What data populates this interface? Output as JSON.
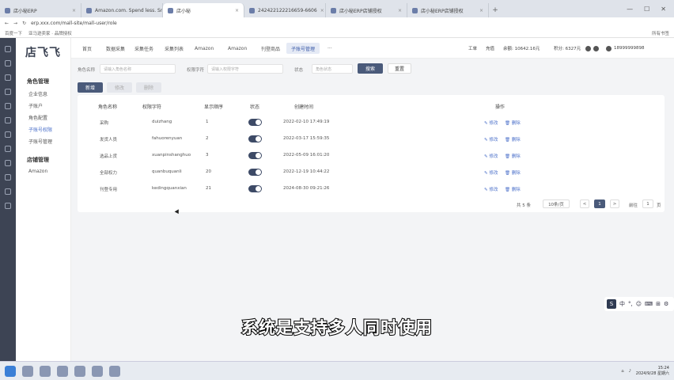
{
  "browser": {
    "tabs": [
      {
        "label": "店小秘ERP"
      },
      {
        "label": "Amazon.com. Spend less. Sr"
      },
      {
        "label": "店小秘"
      },
      {
        "label": "242422122216659-6606"
      },
      {
        "label": "店小秘ERP店铺授权"
      },
      {
        "label": "店小秘ERP店铺授权"
      }
    ],
    "active_tab": 2,
    "url": "erp.xxx.com/mall-site/mall-user/role",
    "bookmarks": [
      "百度一下",
      "亚马逊卖家 · 品牌授权"
    ],
    "bookmarks_right": "所有书签"
  },
  "app": {
    "logo": "店飞飞",
    "sidebar": {
      "groups": [
        {
          "title": "角色管理",
          "items": [
            "企业信息",
            "子账户",
            "角色配置",
            "子账号权限",
            "子账号管理"
          ]
        },
        {
          "title": "店铺管理",
          "items": [
            "Amazon"
          ]
        }
      ]
    },
    "topnav": {
      "tabs": [
        "首页",
        "数据采集",
        "采集任务",
        "采集列表",
        "Amazon",
        "Amazon",
        "刊登商品",
        "子账号管理"
      ],
      "more": "···",
      "balance_label": "工单",
      "recharge": "充值",
      "balance": "余额: 10642.16元",
      "points": "积分: 6327元",
      "phone": "18999999898"
    },
    "filters": [
      {
        "label": "角色名称",
        "placeholder": "请输入角色名称"
      },
      {
        "label": "权限字符",
        "placeholder": "请输入权限字符"
      },
      {
        "label": "状态",
        "placeholder": "角色状态"
      }
    ],
    "search_btn": "搜索",
    "reset_btn": "重置",
    "actions": [
      "新增",
      "修改",
      "删除"
    ],
    "table": {
      "headers": [
        "角色名称",
        "权限字符",
        "显示顺序",
        "状态",
        "创建时间",
        "操作"
      ],
      "rows": [
        {
          "name": "采购",
          "key": "duizhang",
          "order": "1",
          "created": "2022-02-10 17:49:19"
        },
        {
          "name": "发货人员",
          "key": "fahuorenyuan",
          "order": "2",
          "created": "2022-03-17 15:59:35"
        },
        {
          "name": "选品上货",
          "key": "xuanpinshanghuo",
          "order": "3",
          "created": "2022-05-09 16:01:20"
        },
        {
          "name": "全部权力",
          "key": "quanbuquanli",
          "order": "20",
          "created": "2022-12-19 10:44:22"
        },
        {
          "name": "刊登专用",
          "key": "kedingquanxian",
          "order": "21",
          "created": "2024-08-30 09:21:26"
        }
      ],
      "op_edit": "修改",
      "op_delete": "删除"
    },
    "pagination": {
      "total": "共 5 条",
      "page_size": "10条/页",
      "prev": "<",
      "current": "1",
      "next": ">",
      "goto": "前往",
      "goto_value": "1",
      "page_unit": "页"
    }
  },
  "subtitle": "系统是支持多人同时使用",
  "floating_tool": {
    "lead": "S",
    "items": [
      "中",
      "°,",
      "☺",
      "⌨",
      "⊞",
      "⚙"
    ]
  },
  "taskbar": {
    "time": "15:24",
    "date": "2024/9/28 星期六"
  }
}
